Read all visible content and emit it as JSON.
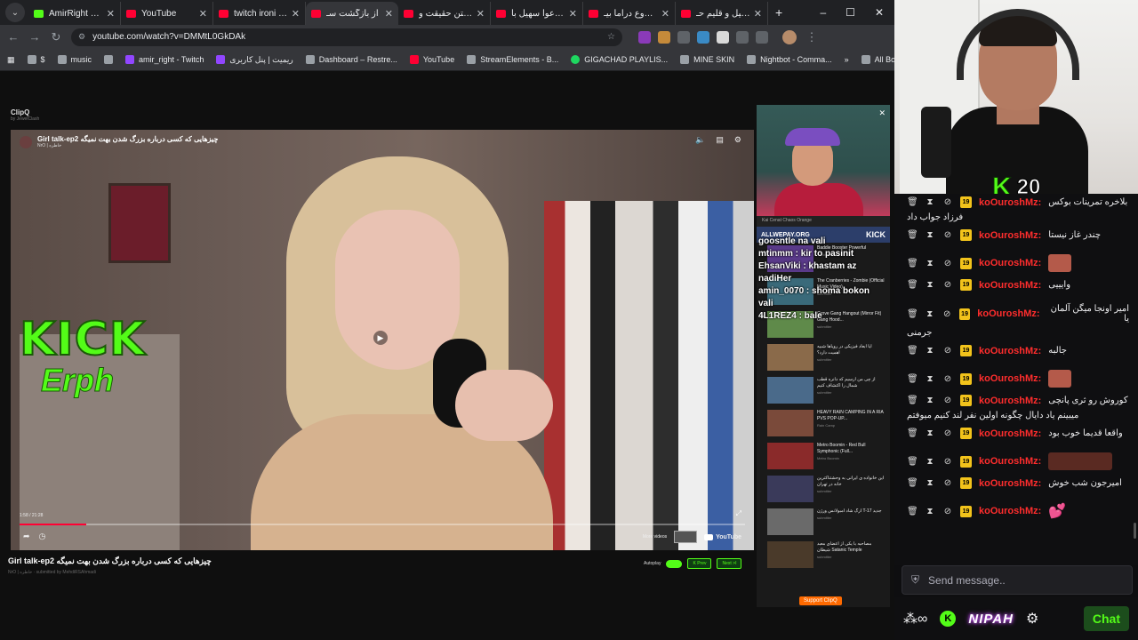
{
  "browser": {
    "tabs": [
      {
        "title": "AmirRight Stre",
        "type": "kick"
      },
      {
        "title": "YouTube",
        "type": "yt"
      },
      {
        "title": "twitch ironi - Yo",
        "type": "yt"
      },
      {
        "title": "از بازگشت سـ",
        "type": "yt",
        "active": true
      },
      {
        "title": "از گفتن حقیقت و",
        "type": "yt"
      },
      {
        "title": "از دعوا سهیل با",
        "type": "yt"
      },
      {
        "title": "از شروع دراما بیـ",
        "type": "yt"
      },
      {
        "title": "سهیل و قلیم حـ",
        "type": "yt"
      }
    ],
    "new_tab": "+",
    "window_controls": [
      "–",
      "☐",
      "✕"
    ],
    "url": "youtube.com/watch?v=DMMtL0GkDAk",
    "bookmarks": [
      "$",
      "music",
      "amir_right - Twitch",
      "ریمیت | پنل کاربری",
      "Dashboard – Restre...",
      "YouTube",
      "StreamElements - B...",
      "GIGACHAD PLAYLIS...",
      "MINE SKIN",
      "Nightbot - Comma..."
    ],
    "all_bookmarks": "All Bookmarks"
  },
  "page": {
    "app_name": "ClipQ",
    "app_sub": "by JewelClash",
    "video": {
      "title": "Girl talk-ep2 چیزهایی که کسی درباره بزرگ شدن بهت نمیگه",
      "channel": "NrO | خاطره",
      "time": "1:58 / 21:28",
      "progress_fraction": 0.092,
      "more_videos": "More videos",
      "youtube_label": "YouTube"
    },
    "watermark": {
      "line1": "KICK",
      "line2": "Erph"
    },
    "below_title": "Girl talk-ep2 چیزهایی که کسی درباره بزرگ شدن بهت نمیگه",
    "below_sub": "NrO | خاطره · submitted by MehdiRSAhmadi",
    "autoplay": "Autoplay",
    "prev": "K Prev",
    "next": "Next >I"
  },
  "sidebar": {
    "top_item": "Kai Cenat Chaos Orange",
    "banner": "ALLWEPAY.ORG",
    "banner_brand": "KICK",
    "items": [
      {
        "title": "Baddie Booster Powerful",
        "sub": "Medina 4Mk"
      },
      {
        "title": "The Cranberries - Zombie (Official Music Video)",
        "sub": "submitter"
      },
      {
        "title": "Grove Gang Hangout (Mirror Fit) Gang Hood...",
        "sub": "submitter"
      },
      {
        "title": "آیا ابعاد فیزیکی در رویاها شبیه اهمیت دارد؟",
        "sub": "submitter"
      },
      {
        "title": "از چی من ارسیم که دانره قطب شمال را اکتشاف کنیم",
        "sub": "submitter"
      },
      {
        "title": "HEAVY RAIN CAMPING IN A RIA PVS POP-UP...",
        "sub": "Rain Camp"
      },
      {
        "title": "Metro Boomin - Red Bull Symphonic (Full...",
        "sub": "Metro Boomin"
      },
      {
        "title": "این خانواده ی ایرانی به وحشتناکترین خانه در تهران",
        "sub": "submitter"
      },
      {
        "title": "ارگ شاد آمبولانس ورژن T-17 جدید",
        "sub": "submitter"
      },
      {
        "title": "مصاحبه با یکی از اعضای معبد شیطان Satanic Temple",
        "sub": "submitter"
      }
    ],
    "support": "Support ClipQ"
  },
  "overlay_chat": [
    "goosntle na vali",
    "mtinmm : kir to pasinit",
    "EhsanViki : khastam az",
    "nadiHer",
    "amin_0070 : shoma bokon",
    "vali",
    "4L1REZ4 : bale"
  ],
  "streamer": {
    "sub_count": "20"
  },
  "chat": {
    "messages": [
      {
        "user": "koOuroshMz:",
        "badge": "19",
        "text": "بلاخره تمرینات بوکس",
        "wrap": "فرزاد جواب داد"
      },
      {
        "user": "koOuroshMz:",
        "badge": "19",
        "text": "چندر غاز نیستا"
      },
      {
        "user": "koOuroshMz:",
        "badge": "19",
        "emote": "face"
      },
      {
        "user": "koOuroshMz:",
        "badge": "19",
        "text": "وایییی"
      },
      {
        "user": "koOuroshMz:",
        "badge": "19",
        "text": "امیر اونجا میگن آلمان یا",
        "wrap": "جرمنی"
      },
      {
        "user": "koOuroshMz:",
        "badge": "19",
        "text": "جالبه"
      },
      {
        "user": "koOuroshMz:",
        "badge": "19",
        "emote": "face"
      },
      {
        "user": "koOuroshMz:",
        "badge": "19",
        "text": "کوروش رو ثری پانچی",
        "wrap": "میبینم یاد دایال چگونه اولین نفر لند کنیم میوفتم"
      },
      {
        "user": "koOuroshMz:",
        "badge": "19",
        "text": "واقعا قدیما خوب بود"
      },
      {
        "user": "koOuroshMz:",
        "badge": "19",
        "emote": "wide"
      },
      {
        "user": "koOuroshMz:",
        "badge": "19",
        "text": "امیرجون شب خوش"
      },
      {
        "user": "koOuroshMz:",
        "badge": "19",
        "emote": "heart"
      }
    ],
    "placeholder": "Send message..",
    "footer_brand": "NIPAH",
    "chat_button": "Chat"
  }
}
